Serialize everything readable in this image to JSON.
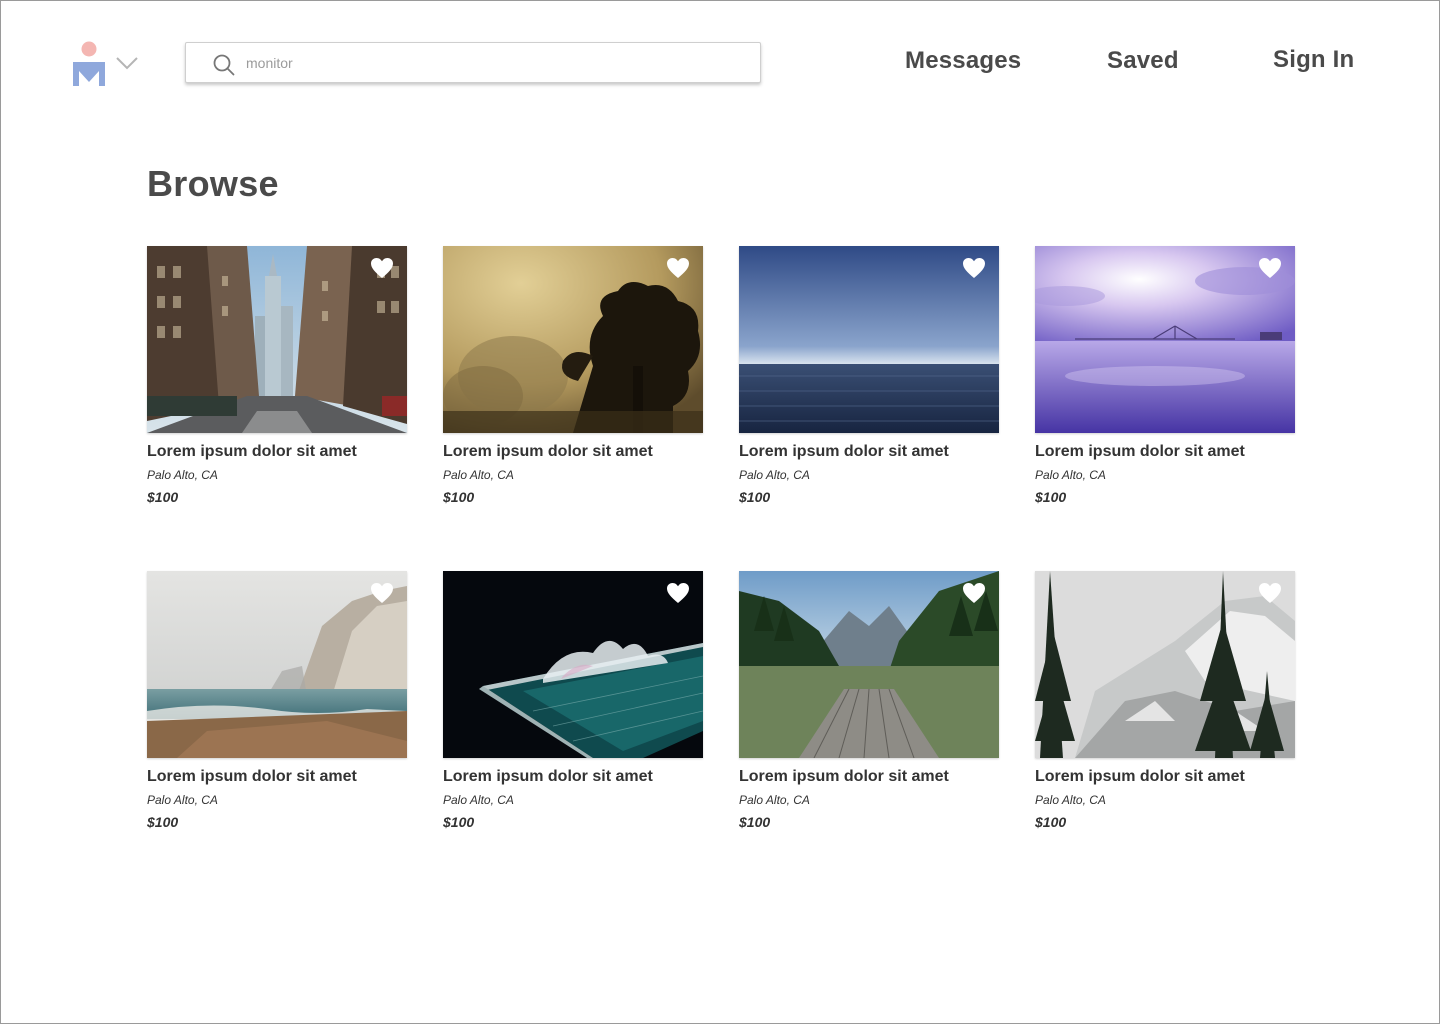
{
  "header": {
    "logo_icon": "person-m-logo-icon",
    "logo_colors": {
      "head": "#f4b6b2",
      "body": "#8fa8dc"
    },
    "dropdown_icon": "chevron-down-icon",
    "search": {
      "icon": "search-icon",
      "placeholder": "monitor",
      "value": ""
    },
    "nav": {
      "messages": "Messages",
      "saved": "Saved",
      "sign_in": "Sign In"
    }
  },
  "main": {
    "title": "Browse",
    "listings": [
      {
        "title": "Lorem ipsum dolor sit amet",
        "location": "Palo Alto, CA",
        "price": "$100",
        "image": "city-street-skyscraper"
      },
      {
        "title": "Lorem ipsum dolor sit amet",
        "location": "Palo Alto, CA",
        "price": "$100",
        "image": "foggy-tree-silhouette"
      },
      {
        "title": "Lorem ipsum dolor sit amet",
        "location": "Palo Alto, CA",
        "price": "$100",
        "image": "calm-ocean-horizon"
      },
      {
        "title": "Lorem ipsum dolor sit amet",
        "location": "Palo Alto, CA",
        "price": "$100",
        "image": "purple-sunset-bridge"
      },
      {
        "title": "Lorem ipsum dolor sit amet",
        "location": "Palo Alto, CA",
        "price": "$100",
        "image": "misty-beach-cliffs"
      },
      {
        "title": "Lorem ipsum dolor sit amet",
        "location": "Palo Alto, CA",
        "price": "$100",
        "image": "night-ocean-pool-wave"
      },
      {
        "title": "Lorem ipsum dolor sit amet",
        "location": "Palo Alto, CA",
        "price": "$100",
        "image": "mountain-lake-dock"
      },
      {
        "title": "Lorem ipsum dolor sit amet",
        "location": "Palo Alto, CA",
        "price": "$100",
        "image": "snowy-mountain-pines"
      }
    ],
    "favorite_icon": "heart-icon"
  }
}
